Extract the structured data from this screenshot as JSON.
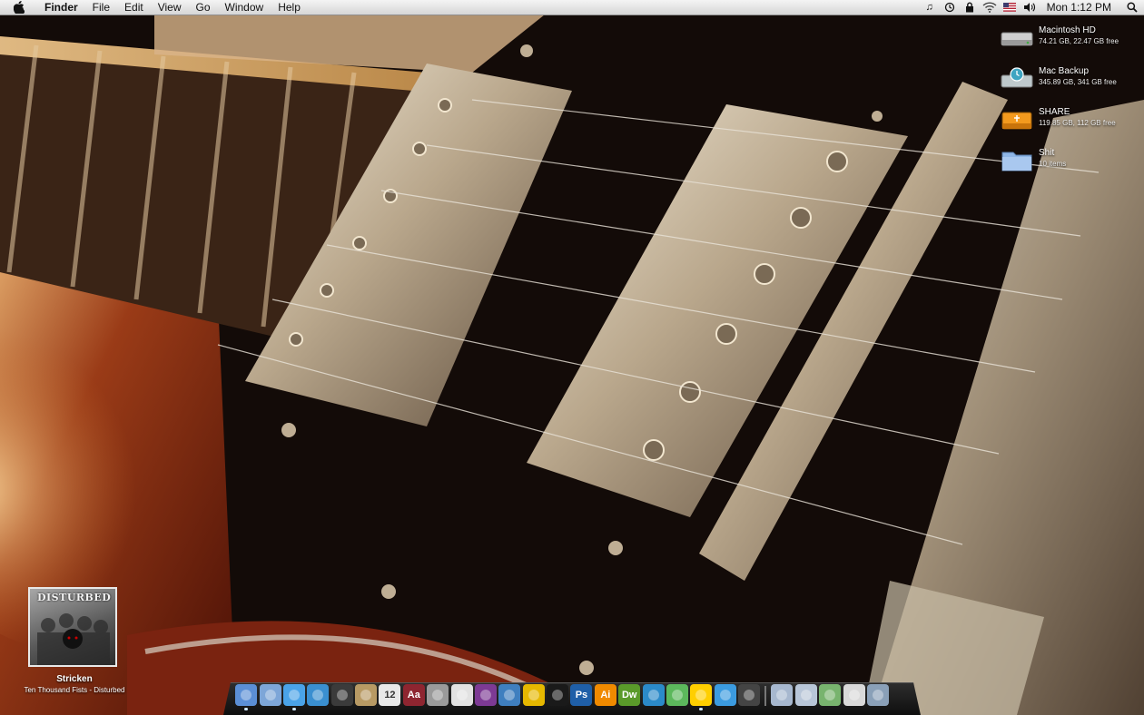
{
  "menubar": {
    "app_name": "Finder",
    "menus": [
      "File",
      "Edit",
      "View",
      "Go",
      "Window",
      "Help"
    ],
    "clock": "Mon 1:12 PM",
    "status_icons": [
      "music-note-icon",
      "time-machine-icon",
      "lock-icon",
      "wifi-icon",
      "flag-icon",
      "volume-icon"
    ]
  },
  "drives": [
    {
      "name": "Macintosh HD",
      "info": "74.21 GB, 22.47 GB free",
      "icon": "hard-drive-icon",
      "color": "#c8c8c8"
    },
    {
      "name": "Mac Backup",
      "info": "345.89 GB, 341 GB free",
      "icon": "backup-drive-icon",
      "color": "#4fb3c9"
    },
    {
      "name": "SHARE",
      "info": "119.85 GB, 112 GB free",
      "icon": "usb-drive-icon",
      "color": "#f39a1e"
    },
    {
      "name": "Shit",
      "info": "10 items",
      "icon": "folder-icon",
      "color": "#8fb6e6"
    }
  ],
  "now_playing": {
    "album_band_text": "DISTURBED",
    "title": "Stricken",
    "subtitle": "Ten Thousand Fists - Disturbed"
  },
  "dock": {
    "items": [
      {
        "name": "finder",
        "label": "",
        "color": "#5b8fd6",
        "running": true
      },
      {
        "name": "mail",
        "label": "",
        "color": "#7da6d8",
        "running": false
      },
      {
        "name": "itunes",
        "label": "",
        "color": "#4aa3e8",
        "running": true
      },
      {
        "name": "safari",
        "label": "",
        "color": "#3a8fd0",
        "running": false
      },
      {
        "name": "adium",
        "label": "",
        "color": "#3b3b3b",
        "running": false
      },
      {
        "name": "address-book",
        "label": "",
        "color": "#b89a64",
        "running": false
      },
      {
        "name": "ical",
        "label": "12",
        "color": "#e8e8e8",
        "running": false
      },
      {
        "name": "dictionary",
        "label": "Aa",
        "color": "#8e2530",
        "running": false
      },
      {
        "name": "calculator",
        "label": "",
        "color": "#9a9a9a",
        "running": false
      },
      {
        "name": "textedit",
        "label": "",
        "color": "#e2e2e2",
        "running": false
      },
      {
        "name": "photo-app",
        "label": "",
        "color": "#7d3a94",
        "running": false
      },
      {
        "name": "iphoto",
        "label": "",
        "color": "#3f7fbf",
        "running": false
      },
      {
        "name": "ftp-app",
        "label": "",
        "color": "#e6b800",
        "running": false
      },
      {
        "name": "terminal",
        "label": "",
        "color": "#1a1a1a",
        "running": false
      },
      {
        "name": "photoshop",
        "label": "Ps",
        "color": "#1f5fa8",
        "running": false
      },
      {
        "name": "illustrator",
        "label": "Ai",
        "color": "#f08a00",
        "running": false
      },
      {
        "name": "dreamweaver",
        "label": "Dw",
        "color": "#5a9a2a",
        "running": false
      },
      {
        "name": "wordpress-app",
        "label": "",
        "color": "#2b8ac9",
        "running": false
      },
      {
        "name": "twitter-app",
        "label": "",
        "color": "#5cb85c",
        "running": false
      },
      {
        "name": "messenger",
        "label": "",
        "color": "#ffcf00",
        "running": true
      },
      {
        "name": "contacts-app",
        "label": "",
        "color": "#3b9be0",
        "running": false
      },
      {
        "name": "movie-app",
        "label": "",
        "color": "#444444",
        "running": false
      }
    ],
    "stack_items": [
      {
        "name": "applications-stack",
        "color": "#a7b8cf"
      },
      {
        "name": "documents-stack",
        "color": "#b8c6d8"
      },
      {
        "name": "downloads-stack",
        "color": "#78b46e"
      },
      {
        "name": "server-stack",
        "color": "#d9d9d9"
      },
      {
        "name": "trash",
        "color": "#8aa0b8"
      }
    ]
  }
}
